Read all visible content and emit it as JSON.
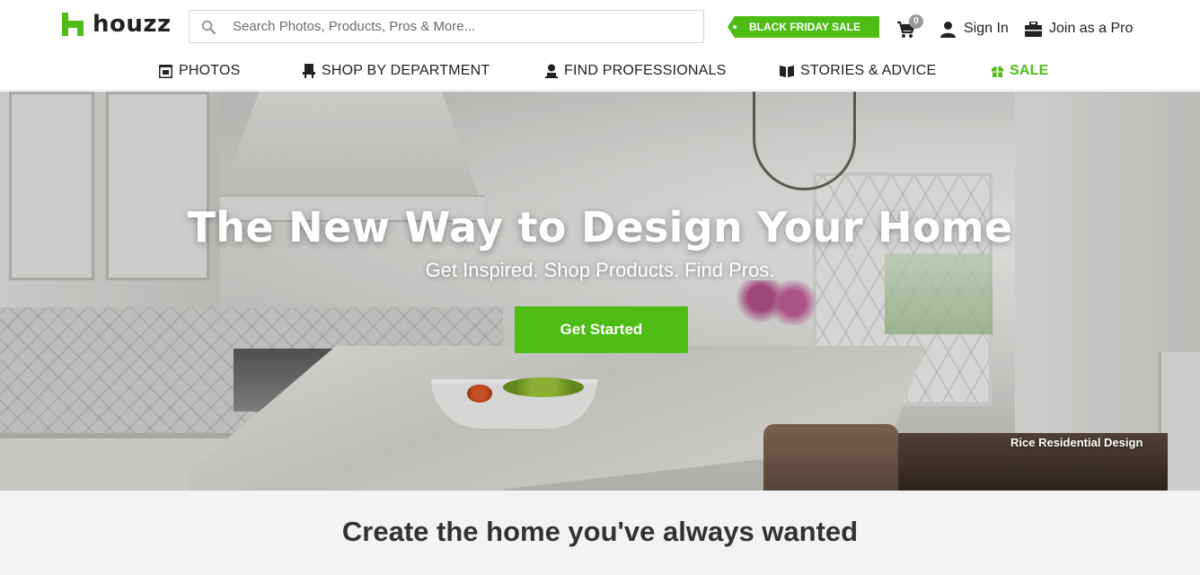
{
  "brand": {
    "name": "houzz",
    "accent": "#4dbc15"
  },
  "search": {
    "placeholder": "Search Photos, Products, Pros & More..."
  },
  "header": {
    "promo_label": "BLACK FRIDAY SALE",
    "cart_count": "0",
    "sign_in_label": "Sign In",
    "join_pro_label": "Join as a Pro"
  },
  "nav": {
    "items": [
      {
        "label": "PHOTOS",
        "icon": "photos-icon"
      },
      {
        "label": "SHOP BY DEPARTMENT",
        "icon": "shop-icon"
      },
      {
        "label": "FIND PROFESSIONALS",
        "icon": "professional-icon"
      },
      {
        "label": "STORIES & ADVICE",
        "icon": "book-icon"
      },
      {
        "label": "SALE",
        "icon": "gift-icon"
      }
    ]
  },
  "hero": {
    "title": "The New Way to Design Your Home",
    "subtitle": "Get Inspired. Shop Products. Find Pros.",
    "cta_label": "Get Started",
    "photo_credit": "Rice Residential Design"
  },
  "section": {
    "heading": "Create the home you've always wanted"
  }
}
